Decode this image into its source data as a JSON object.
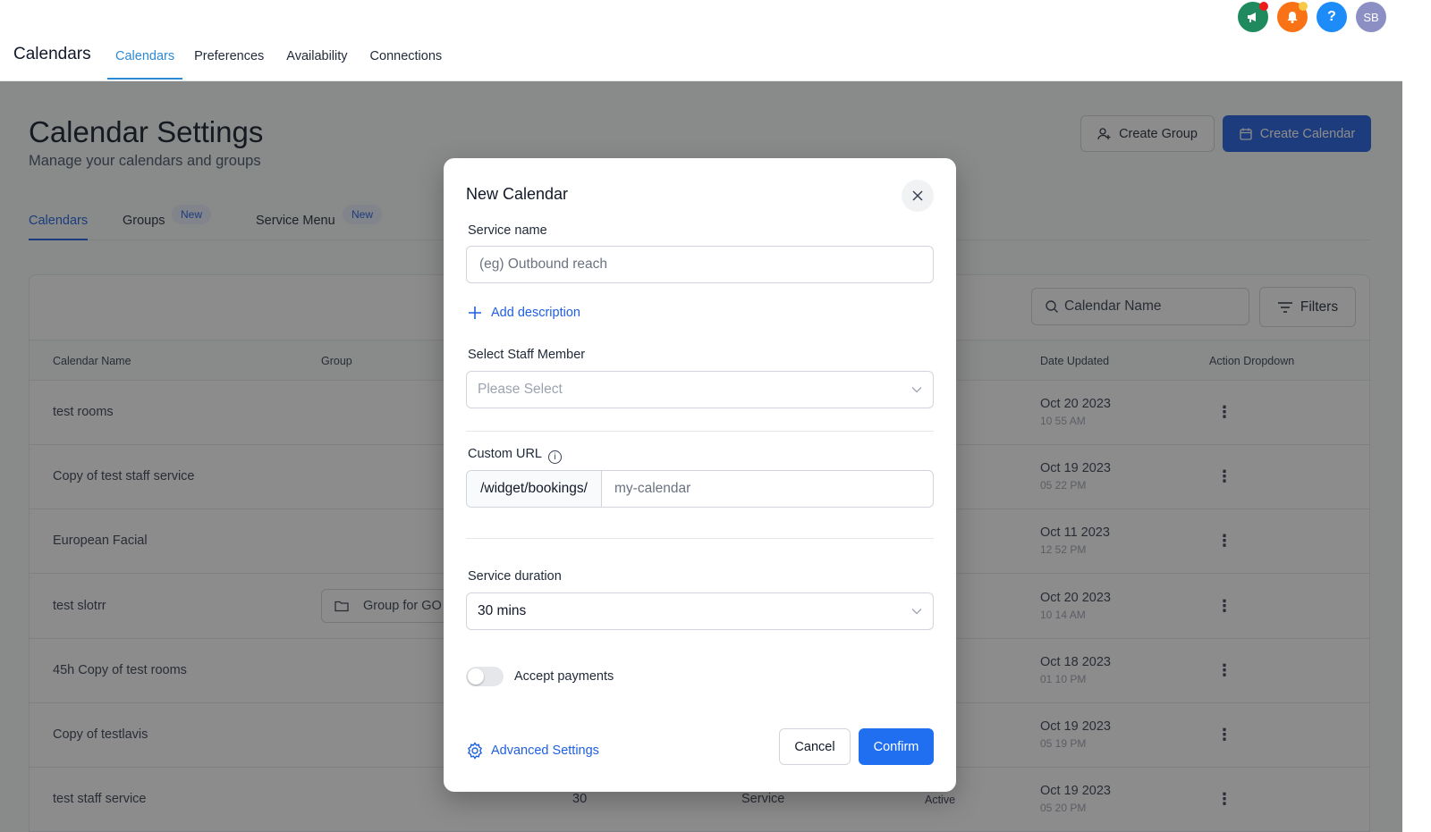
{
  "header": {
    "app_title": "Calendars",
    "tabs": [
      {
        "label": "Calendars",
        "active": true
      },
      {
        "label": "Preferences",
        "active": false
      },
      {
        "label": "Availability",
        "active": false
      },
      {
        "label": "Connections",
        "active": false
      }
    ],
    "icons": {
      "announcement": "megaphone-icon",
      "notifications": "bell-icon",
      "help_label": "?",
      "avatar_initials": "SB"
    }
  },
  "page": {
    "title": "Calendar Settings",
    "subtitle": "Manage your calendars and groups",
    "create_group_label": "Create Group",
    "create_calendar_label": "Create Calendar",
    "sub_tabs": {
      "calendars": "Calendars",
      "groups": "Groups",
      "service_menu": "Service Menu",
      "new_badge": "New"
    },
    "search_placeholder": "Calendar Name",
    "filters_label": "Filters",
    "columns": {
      "calendar_name": "Calendar Name",
      "group": "Group",
      "date_updated": "Date Updated",
      "action": "Action Dropdown"
    },
    "rows": [
      {
        "name": "test rooms",
        "date": "Oct 20 2023",
        "time": "10 55 AM"
      },
      {
        "name": "Copy of test staff service",
        "date": "Oct 19 2023",
        "time": "05 22 PM"
      },
      {
        "name": "European Facial",
        "date": "Oct 11 2023",
        "time": "12 52 PM"
      },
      {
        "name": "test slotrr",
        "group": "Group for GO",
        "date": "Oct 20 2023",
        "time": "10 14 AM"
      },
      {
        "name": "45h Copy of test rooms",
        "date": "Oct 18 2023",
        "time": "01 10 PM"
      },
      {
        "name": "Copy of testlavis",
        "date": "Oct 19 2023",
        "time": "05 19 PM"
      },
      {
        "name": "test staff service",
        "duration": "30",
        "type": "Service",
        "status": "Active",
        "date": "Oct 19 2023",
        "time": "05 20 PM"
      }
    ],
    "dots": "⋮"
  },
  "modal": {
    "title": "New Calendar",
    "service_name_label": "Service name",
    "service_name_placeholder": "(eg) Outbound reach",
    "add_description_label": "Add description",
    "staff_label": "Select Staff Member",
    "staff_placeholder": "Please Select",
    "custom_url_label": "Custom URL",
    "url_prefix": "/widget/bookings/",
    "url_value": "my-calendar",
    "duration_label": "Service duration",
    "duration_value": "30 mins",
    "accept_payments_label": "Accept payments",
    "accept_payments_on": false,
    "advanced_settings_label": "Advanced Settings",
    "cancel_label": "Cancel",
    "confirm_label": "Confirm"
  },
  "colors": {
    "primary": "#1f5fe0",
    "confirm": "#1f6ff0",
    "tab_active": "#2b8ad6"
  }
}
